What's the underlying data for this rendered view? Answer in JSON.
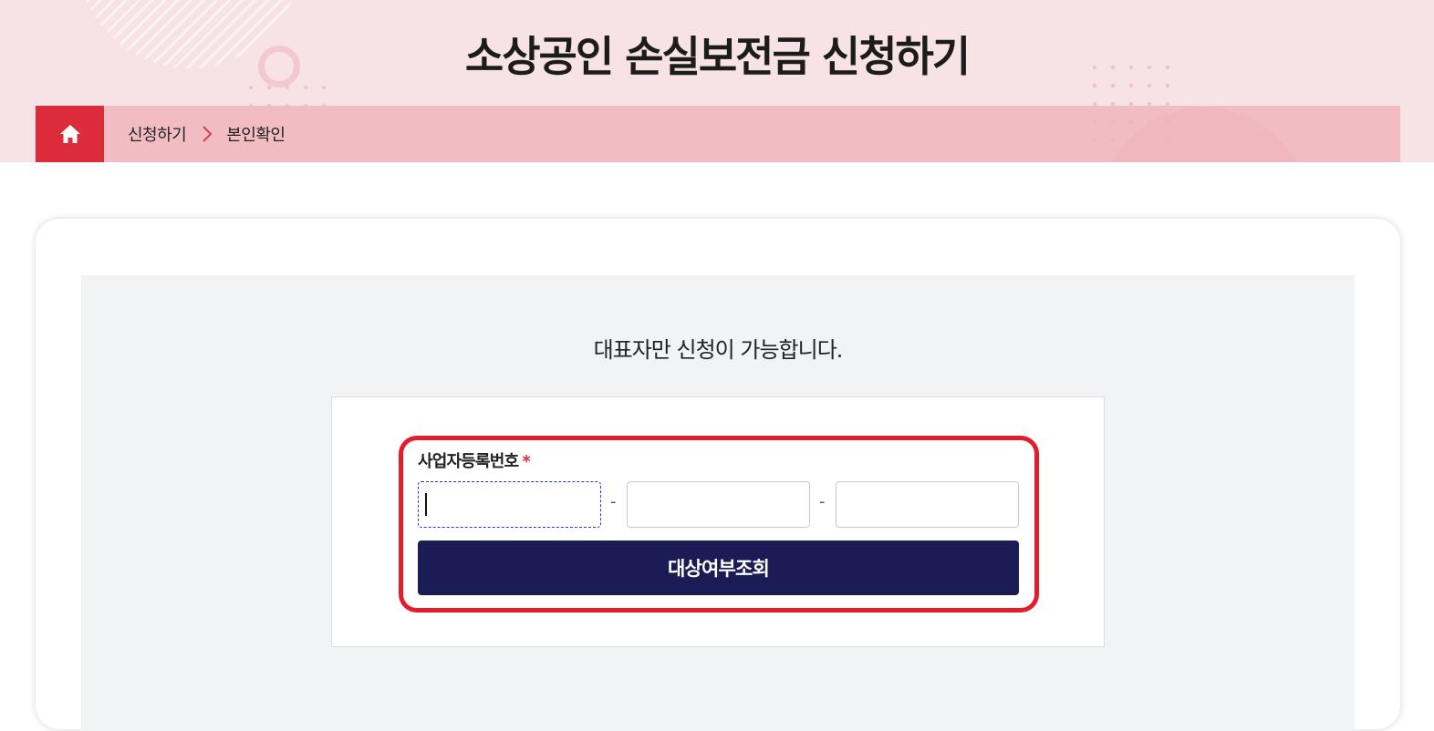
{
  "header": {
    "title": "소상공인 손실보전금 신청하기"
  },
  "breadcrumb": {
    "home_icon": "home-icon",
    "items": [
      "신청하기",
      "본인확인"
    ],
    "separator_icon": "chevron-right-icon"
  },
  "main": {
    "notice": "대표자만 신청이 가능합니다.",
    "form": {
      "label": "사업자등록번호",
      "required_mark": "*",
      "separator": "-",
      "fields": [
        {
          "value": "",
          "placeholder": ""
        },
        {
          "value": "",
          "placeholder": ""
        },
        {
          "value": "",
          "placeholder": ""
        }
      ],
      "submit_label": "대상여부조회"
    }
  },
  "colors": {
    "accent_red": "#dc2b3b",
    "button_navy": "#1b1c55",
    "highlight_border": "#e41d2c",
    "hero_bg": "#f7e3e6"
  }
}
